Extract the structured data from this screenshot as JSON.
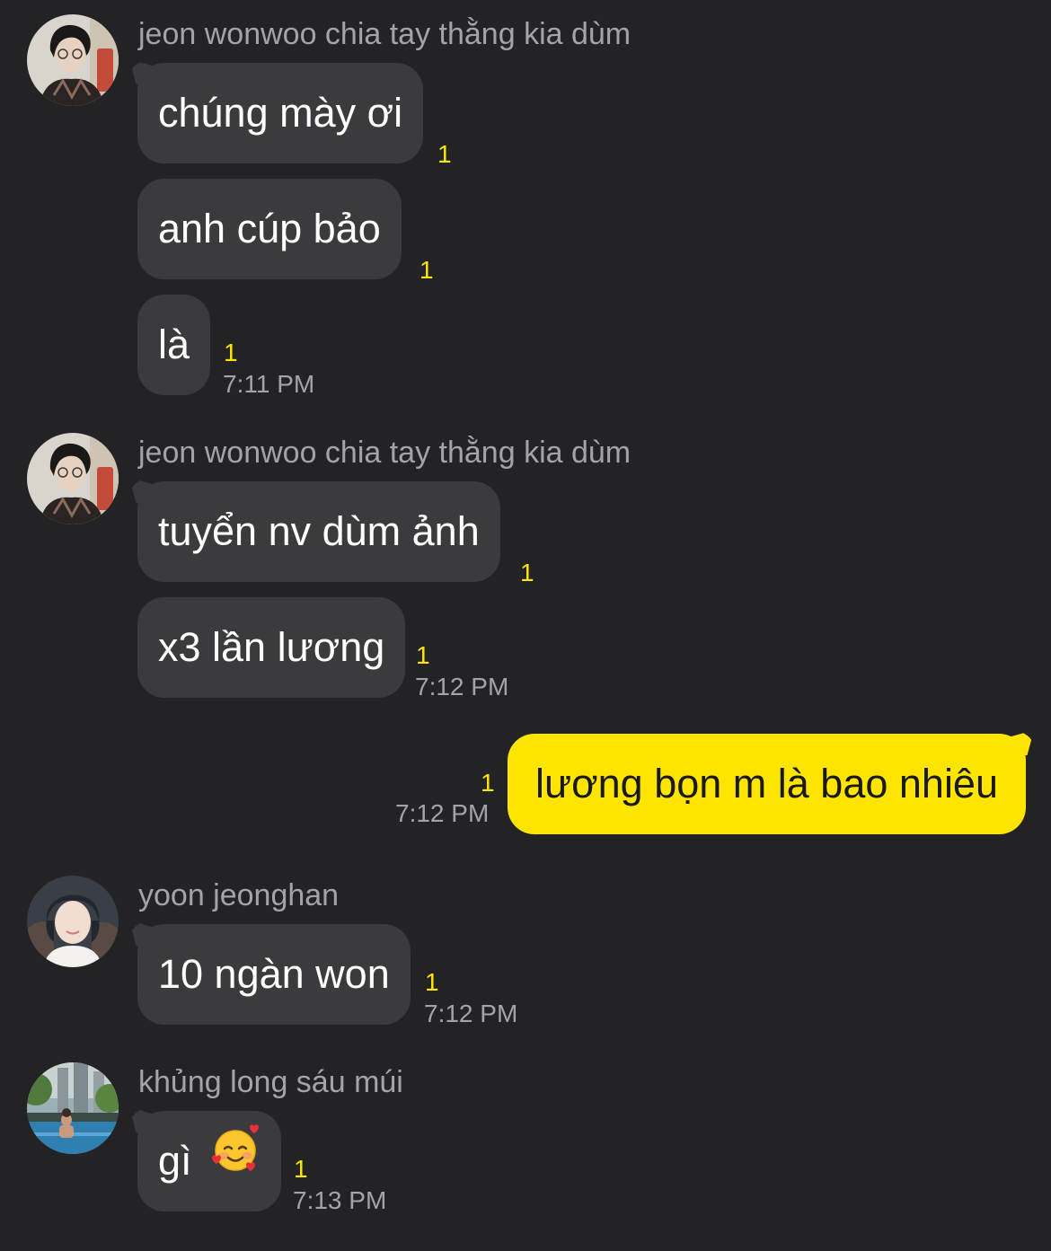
{
  "colors": {
    "background": "#232325",
    "incoming_bubble": "#3b3b3d",
    "outgoing_bubble": "#fee500",
    "unread_count": "#fee500",
    "meta_text": "#a4a4a8"
  },
  "groups": [
    {
      "sender": "jeon wonwoo chia tay thằng kia dùm",
      "avatar_icon": "profile-photo-wonwoo-icon",
      "messages": [
        {
          "text": "chúng mày ơi",
          "unread": "1"
        },
        {
          "text": "anh cúp bảo",
          "unread": "1"
        },
        {
          "text": "là",
          "unread": "1",
          "time": "7:11 PM"
        }
      ]
    },
    {
      "sender": "jeon wonwoo chia tay thằng kia dùm",
      "avatar_icon": "profile-photo-wonwoo-icon",
      "messages": [
        {
          "text": "tuyển nv dùm ảnh",
          "unread": "1"
        },
        {
          "text": "x3 lần lương",
          "unread": "1",
          "time": "7:12 PM"
        }
      ]
    },
    {
      "outgoing": true,
      "messages": [
        {
          "text": "lương bọn m là bao nhiêu",
          "unread": "1",
          "time": "7:12 PM"
        }
      ]
    },
    {
      "sender": "yoon jeonghan",
      "avatar_icon": "profile-photo-jeonghan-icon",
      "messages": [
        {
          "text": "10 ngàn won",
          "unread": "1",
          "time": "7:12 PM"
        }
      ]
    },
    {
      "sender": "khủng long sáu múi",
      "avatar_icon": "profile-photo-pool-icon",
      "messages": [
        {
          "text": "gì",
          "emoji": "smiling-face-with-hearts-emoji",
          "unread": "1",
          "time": "7:13 PM"
        }
      ]
    }
  ]
}
